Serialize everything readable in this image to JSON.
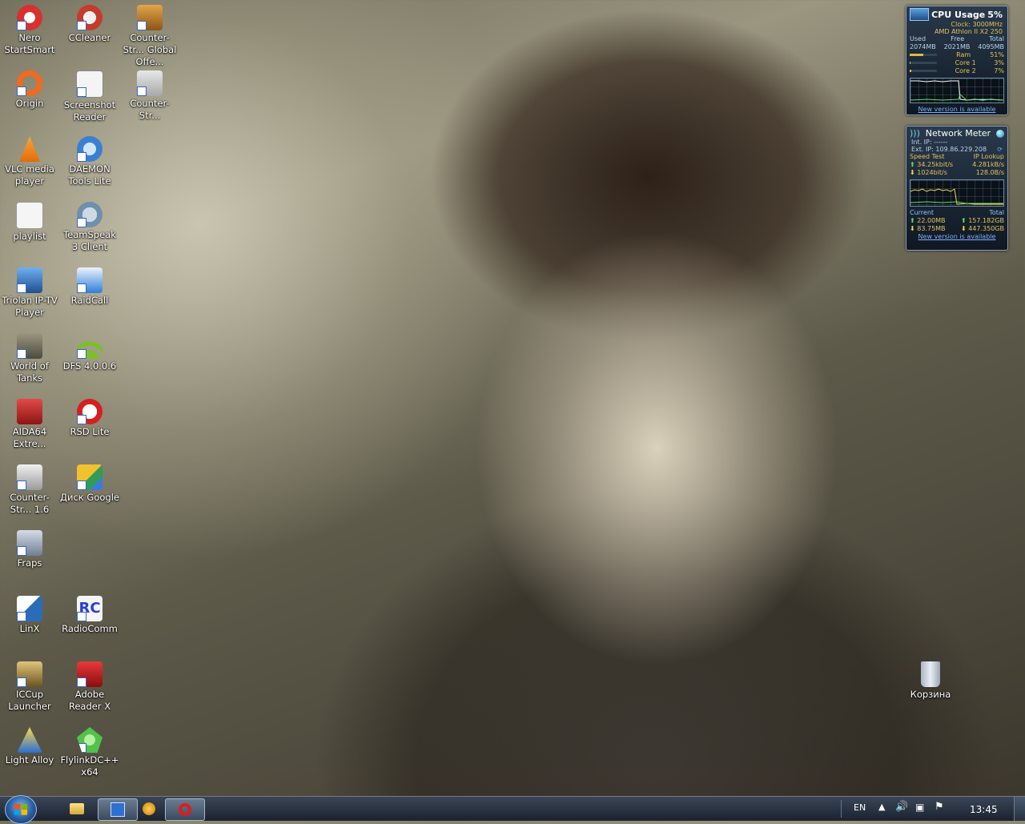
{
  "desktop": {
    "icons": [
      {
        "label": "Nero StartSmart",
        "color": "#d83030"
      },
      {
        "label": "CCleaner",
        "color": "#c53b2b"
      },
      {
        "label": "Counter-Str... Global Offe...",
        "color": "#c98a2a"
      },
      {
        "label": "Origin",
        "color": "#f26a1b"
      },
      {
        "label": "Screenshot Reader",
        "color": "#e9e9e9"
      },
      {
        "label": "Counter-Str...",
        "color": "#cfcfcf"
      },
      {
        "label": "VLC media player",
        "color": "#f08a16"
      },
      {
        "label": "DAEMON Tools Lite",
        "color": "#3a7fd0"
      },
      {
        "label": "playlist",
        "color": "#f5f5f5"
      },
      {
        "label": "TeamSpeak 3 Client",
        "color": "#6e8fae"
      },
      {
        "label": "Triolan IP-TV Player",
        "color": "#2d6fb3"
      },
      {
        "label": "RaidCall",
        "color": "#2f7dd6"
      },
      {
        "label": "World of Tanks",
        "color": "#6f6b5d"
      },
      {
        "label": "DFS 4.0.0.6",
        "color": "#7bbf2a"
      },
      {
        "label": "AIDA64 Extre...",
        "color": "#c02525"
      },
      {
        "label": "RSD Lite",
        "color": "#d42020"
      },
      {
        "label": "Counter-Str... 1.6",
        "color": "#cfcfcf"
      },
      {
        "label": "Диск Google",
        "color": "#f2c12e"
      },
      {
        "label": "Fraps",
        "color": "#e8e83a"
      },
      {
        "label": "LinX",
        "color": "#2b6cb8"
      },
      {
        "label": "RadioComm",
        "color": "#2a3fd6"
      },
      {
        "label": "ICCup Launcher",
        "color": "#c8a23a"
      },
      {
        "label": "Adobe Reader X",
        "color": "#c81e1e"
      },
      {
        "label": "Light Alloy",
        "color": "#2a6fd3"
      },
      {
        "label": "FlylinkDC++ x64",
        "color": "#52c24a"
      },
      {
        "label": "Корзина",
        "color": "#cfd8e0"
      }
    ]
  },
  "cpu_gadget": {
    "title": "CPU Usage",
    "usage": "5%",
    "clock": "Clock: 3000MHz",
    "cpu_name": "AMD Athlon II X2 250",
    "mem_headers": [
      "Used",
      "Free",
      "Total"
    ],
    "mem_values": [
      "2074MB",
      "2021MB",
      "4095MB"
    ],
    "rows": [
      {
        "label": "Ram",
        "value": "51%",
        "fill": 0.51
      },
      {
        "label": "Core 1",
        "value": "3%",
        "fill": 0.03
      },
      {
        "label": "Core 2",
        "value": "7%",
        "fill": 0.07
      }
    ],
    "link": "New version is available"
  },
  "net_gadget": {
    "title": "Network Meter",
    "int_ip": "Int. IP: ------",
    "ext_ip": "Ext. IP: 109.86.229.208",
    "speed_test": "Speed Test",
    "ip_lookup": "IP Lookup",
    "up_speed": "34.25kbit/s",
    "up_rate": "4.281kB/s",
    "down_speed": "1024bit/s",
    "down_rate": "128.0B/s",
    "current": "Current",
    "total": "Total",
    "cur_up": "22.00MB",
    "cur_down": "83.75MB",
    "tot_up": "157.182GB",
    "tot_down": "447.350GB",
    "link": "New version is available"
  },
  "taskbar": {
    "language": "EN",
    "time": "13:45"
  }
}
